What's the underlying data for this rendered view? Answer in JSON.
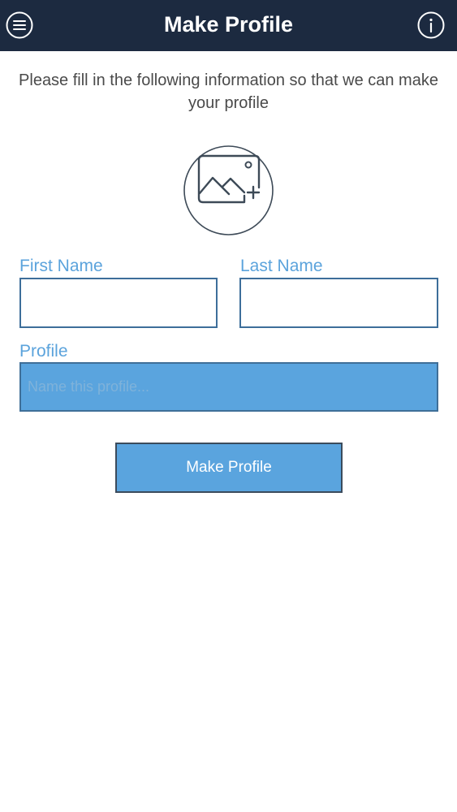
{
  "header": {
    "title": "Make Profile",
    "menu_icon": "hamburger-menu-icon",
    "info_icon": "info-icon",
    "background": "#1c2a40"
  },
  "intro": {
    "text": "Please fill in the following information so that we can make your profile"
  },
  "photo": {
    "icon": "add-photo-icon"
  },
  "form": {
    "first_name_label": "First Name",
    "first_name_value": "",
    "last_name_label": "Last Name",
    "last_name_value": "",
    "profile_label": "Profile",
    "profile_value": "",
    "profile_placeholder": "Name this profile..."
  },
  "actions": {
    "submit_label": "Make Profile"
  },
  "colors": {
    "accent": "#5aa4de",
    "label": "#5ba3dc",
    "border": "#3d6e9a"
  }
}
